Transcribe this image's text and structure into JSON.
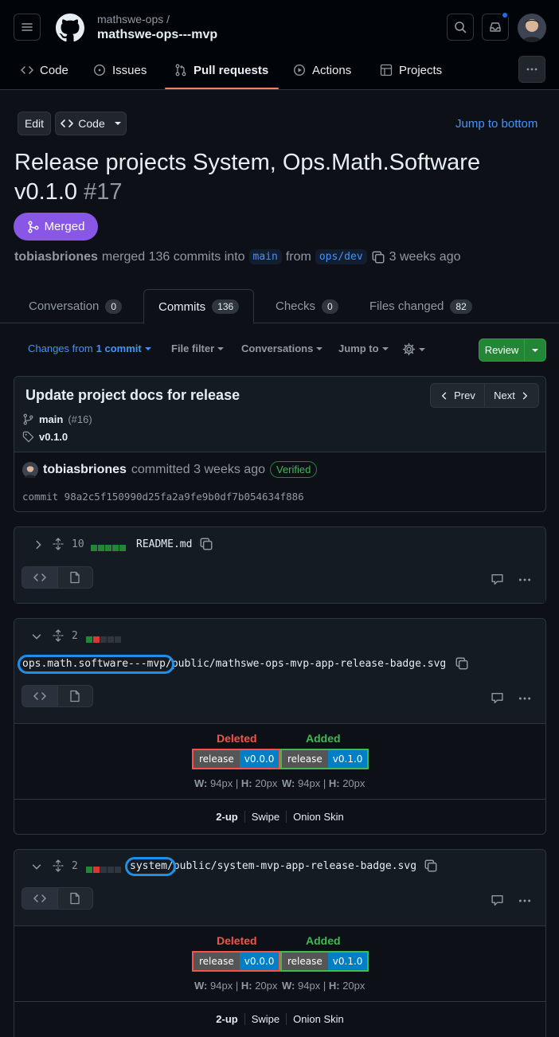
{
  "header": {
    "owner": "mathswe-ops /",
    "repo": "mathswe-ops---mvp",
    "nav": [
      {
        "label": "Code",
        "icon": "code-icon"
      },
      {
        "label": "Issues",
        "icon": "issue-icon"
      },
      {
        "label": "Pull requests",
        "icon": "pull-request-icon"
      },
      {
        "label": "Actions",
        "icon": "play-icon"
      },
      {
        "label": "Projects",
        "icon": "table-icon"
      }
    ]
  },
  "actions": {
    "edit": "Edit",
    "code": "Code",
    "jump_bottom": "Jump to bottom"
  },
  "pr": {
    "title": "Release projects System, Ops.Math.Software v0.1.0",
    "number": "#17",
    "state": "Merged",
    "author": "tobiasbriones",
    "merge_text": "merged 136 commits into",
    "base": "main",
    "from": "from",
    "head": "ops/dev",
    "time": "3 weeks ago"
  },
  "tabs": [
    {
      "label": "Conversation",
      "count": "0"
    },
    {
      "label": "Commits",
      "count": "136"
    },
    {
      "label": "Checks",
      "count": "0"
    },
    {
      "label": "Files changed",
      "count": "82"
    }
  ],
  "toolbar": {
    "changes_prefix": "Changes from",
    "changes_value": "1 commit",
    "file_filter": "File filter",
    "conversations": "Conversations",
    "jump_to": "Jump to",
    "review": "Review"
  },
  "commit": {
    "title": "Update project docs for release",
    "prev": "Prev",
    "next": "Next",
    "branch": "main",
    "branch_pr": "(#16)",
    "tag": "v0.1.0",
    "author": "tobiasbriones",
    "committed": "committed 3 weeks ago",
    "verified": "Verified",
    "sha": "commit 98a2c5f150990d25fa2a9fe9b0df7b054634f886"
  },
  "files": [
    {
      "changes": "10",
      "name": "README.md",
      "diffstat": [
        "g",
        "g",
        "g",
        "g",
        "g"
      ]
    },
    {
      "changes": "2",
      "name_hl": "ops.math.software---mvp/",
      "name_rest": "public/mathswe-ops-mvp-app-release-badge.svg",
      "diffstat": [
        "g",
        "r",
        "n",
        "n",
        "n"
      ]
    },
    {
      "changes": "2",
      "name_hl": "system/",
      "name_rest": "public/system-mvp-app-release-badge.svg",
      "diffstat": [
        "g",
        "r",
        "n",
        "n",
        "n"
      ]
    }
  ],
  "imageview": {
    "deleted": "Deleted",
    "added": "Added",
    "badge_label": "release",
    "old_version": "v0.0.0",
    "new_version": "v0.1.0",
    "w_label": "W:",
    "w_value": "94px",
    "h_label": "H:",
    "h_value": "20px",
    "sep": "|",
    "modes": [
      "2-up",
      "Swipe",
      "Onion Skin"
    ]
  },
  "colors": {
    "accent": "#4493f8",
    "merged": "#8957e5",
    "deleted": "#f85149",
    "added": "#3fb950",
    "highlight": "#1f8fe8"
  }
}
